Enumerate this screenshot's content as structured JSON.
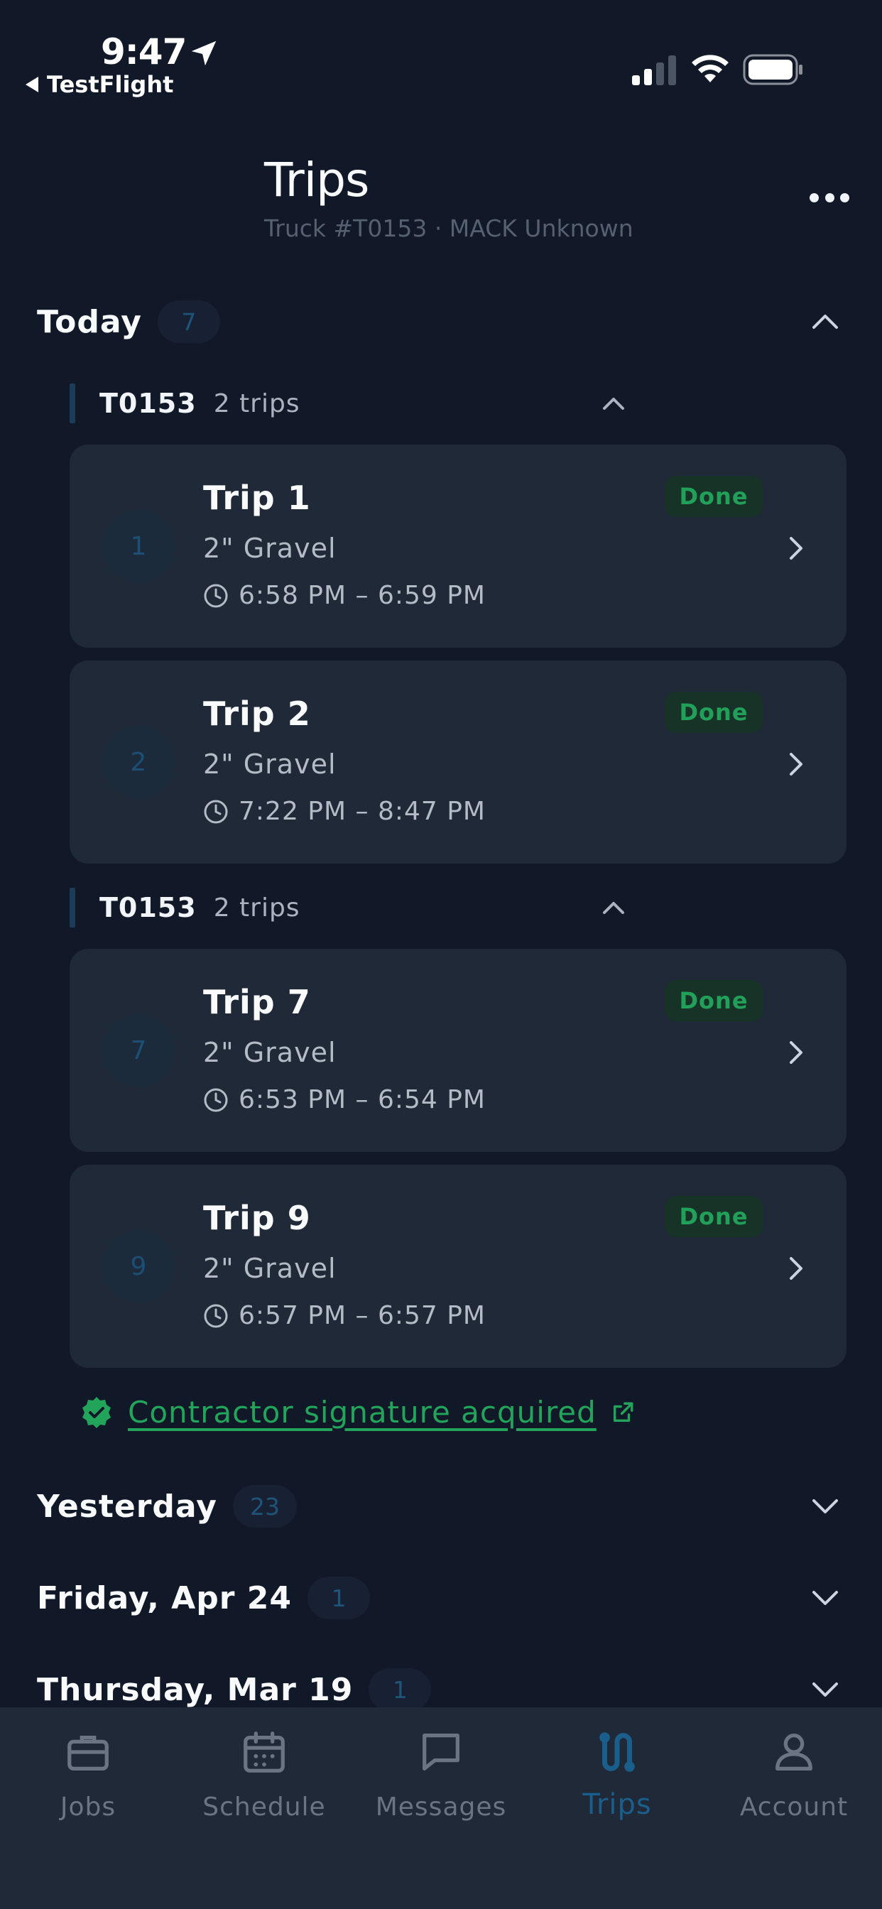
{
  "status_bar": {
    "time": "9:47",
    "back_app": "TestFlight"
  },
  "header": {
    "title": "Trips",
    "subtitle": "Truck #T0153 · MACK Unknown"
  },
  "sections": [
    {
      "label": "Today",
      "count": "7",
      "expanded": true
    },
    {
      "label": "Yesterday",
      "count": "23",
      "expanded": false
    },
    {
      "label": "Friday, Apr 24",
      "count": "1",
      "expanded": false
    },
    {
      "label": "Thursday, Mar 19",
      "count": "1",
      "expanded": false
    }
  ],
  "groups": [
    {
      "name": "T0153",
      "trips_label": "2 trips",
      "trips": [
        {
          "number": "1",
          "title": "Trip 1",
          "material": "2\" Gravel",
          "time": "6:58 PM – 6:59 PM",
          "status": "Done"
        },
        {
          "number": "2",
          "title": "Trip 2",
          "material": "2\" Gravel",
          "time": "7:22 PM – 8:47 PM",
          "status": "Done"
        }
      ]
    },
    {
      "name": "T0153",
      "trips_label": "2 trips",
      "trips": [
        {
          "number": "7",
          "title": "Trip 7",
          "material": "2\" Gravel",
          "time": "6:53 PM – 6:54 PM",
          "status": "Done"
        },
        {
          "number": "9",
          "title": "Trip 9",
          "material": "2\" Gravel",
          "time": "6:57 PM – 6:57 PM",
          "status": "Done"
        }
      ]
    }
  ],
  "signature": {
    "text": "Contractor signature acquired"
  },
  "tabs": [
    {
      "label": "Jobs",
      "icon": "briefcase-icon",
      "active": false
    },
    {
      "label": "Schedule",
      "icon": "calendar-icon",
      "active": false
    },
    {
      "label": "Messages",
      "icon": "message-icon",
      "active": false
    },
    {
      "label": "Trips",
      "icon": "route-icon",
      "active": true
    },
    {
      "label": "Account",
      "icon": "user-icon",
      "active": false
    }
  ],
  "colors": {
    "background": "#111827",
    "card": "#1f2937",
    "accent": "#1a5e8c",
    "success": "#22a55b"
  }
}
